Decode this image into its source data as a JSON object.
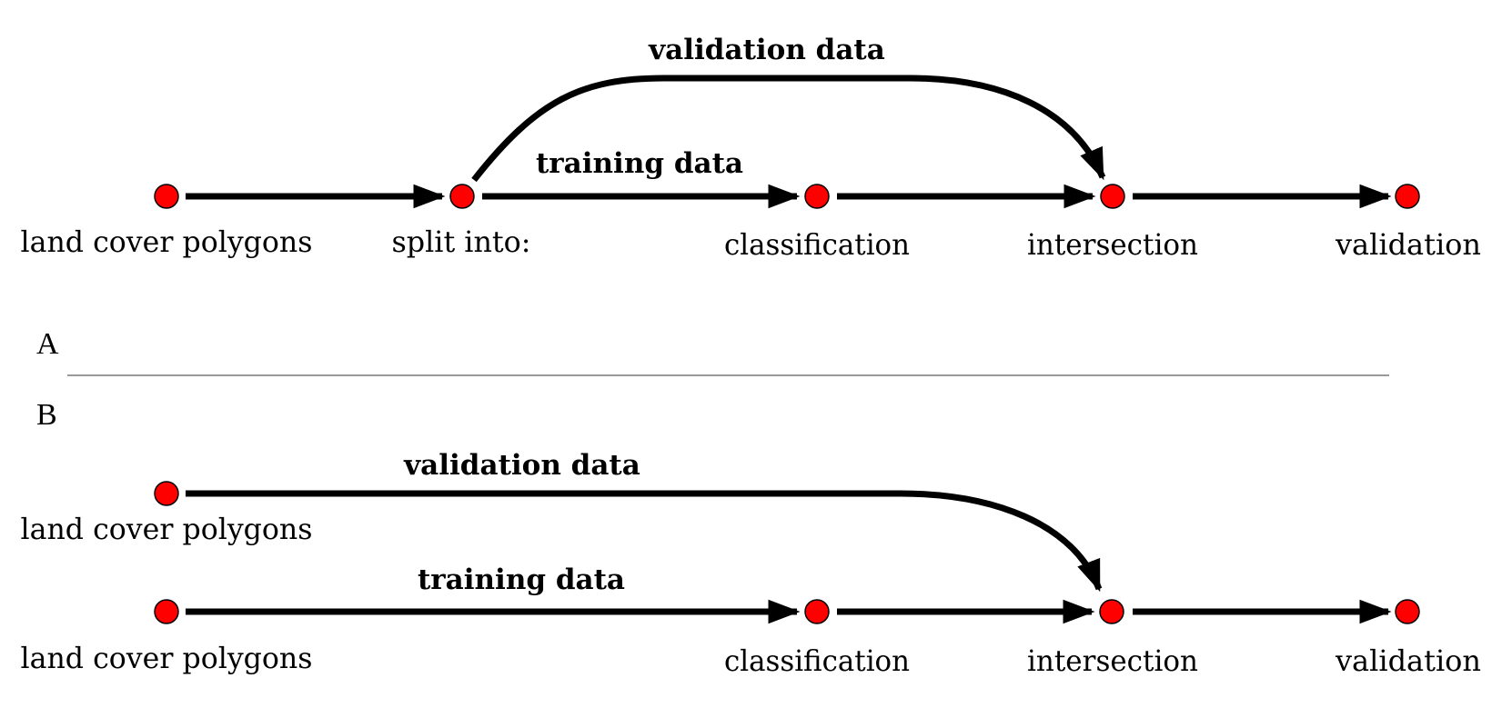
{
  "colors": {
    "node_fill": "#ff0000",
    "edge": "#000000",
    "separator": "#999999"
  },
  "panels": {
    "a_label": "A",
    "b_label": "B"
  },
  "panel_a": {
    "nodes": [
      {
        "id": "a-land-cover",
        "label": "land cover polygons"
      },
      {
        "id": "a-split",
        "label": "split into:"
      },
      {
        "id": "a-classification",
        "label": "classification"
      },
      {
        "id": "a-intersection",
        "label": "intersection"
      },
      {
        "id": "a-validation",
        "label": "validation"
      }
    ],
    "edges": [
      {
        "from": "a-land-cover",
        "to": "a-split",
        "label": ""
      },
      {
        "from": "a-split",
        "to": "a-classification",
        "label": "training data"
      },
      {
        "from": "a-split",
        "to": "a-intersection",
        "label": "validation data",
        "curved": true
      },
      {
        "from": "a-classification",
        "to": "a-intersection",
        "label": ""
      },
      {
        "from": "a-intersection",
        "to": "a-validation",
        "label": ""
      }
    ],
    "training_label": "training data",
    "validation_label": "validation data"
  },
  "panel_b": {
    "nodes": [
      {
        "id": "b-land-cover-validation",
        "label": "land cover polygons"
      },
      {
        "id": "b-land-cover-training",
        "label": "land cover polygons"
      },
      {
        "id": "b-classification",
        "label": "classification"
      },
      {
        "id": "b-intersection",
        "label": "intersection"
      },
      {
        "id": "b-validation",
        "label": "validation"
      }
    ],
    "edges": [
      {
        "from": "b-land-cover-validation",
        "to": "b-intersection",
        "label": "validation data",
        "curved": true
      },
      {
        "from": "b-land-cover-training",
        "to": "b-classification",
        "label": "training data"
      },
      {
        "from": "b-classification",
        "to": "b-intersection",
        "label": ""
      },
      {
        "from": "b-intersection",
        "to": "b-validation",
        "label": ""
      }
    ],
    "training_label": "training data",
    "validation_label": "validation data"
  }
}
